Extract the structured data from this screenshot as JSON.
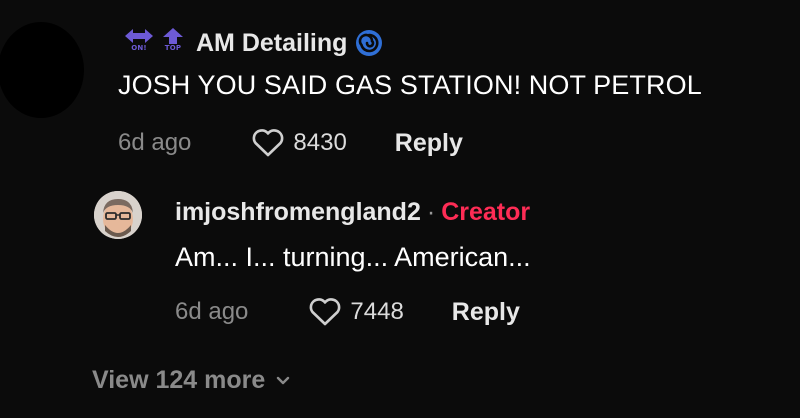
{
  "colors": {
    "background": "#0b0b0b",
    "creator": "#fe2c55",
    "badge": "#6d5ad6",
    "verified": "#2f6fd6",
    "muted": "#8a8a8a"
  },
  "comments": [
    {
      "badges": [
        {
          "icon": "double-arrow-icon",
          "label": "ON!"
        },
        {
          "icon": "arrow-up-icon",
          "label": "TOP"
        }
      ],
      "username": "AM Detailing",
      "verified_icon": "spiral-badge-icon",
      "text": "JOSH YOU SAID GAS STATION! NOT PETROL",
      "time": "6d ago",
      "likes": "8430",
      "reply_label": "Reply"
    },
    {
      "username": "imjoshfromengland2",
      "separator": "·",
      "role": "Creator",
      "text": "Am... I... turning... American...",
      "time": "6d ago",
      "likes": "7448",
      "reply_label": "Reply"
    }
  ],
  "view_more": "View 124 more"
}
